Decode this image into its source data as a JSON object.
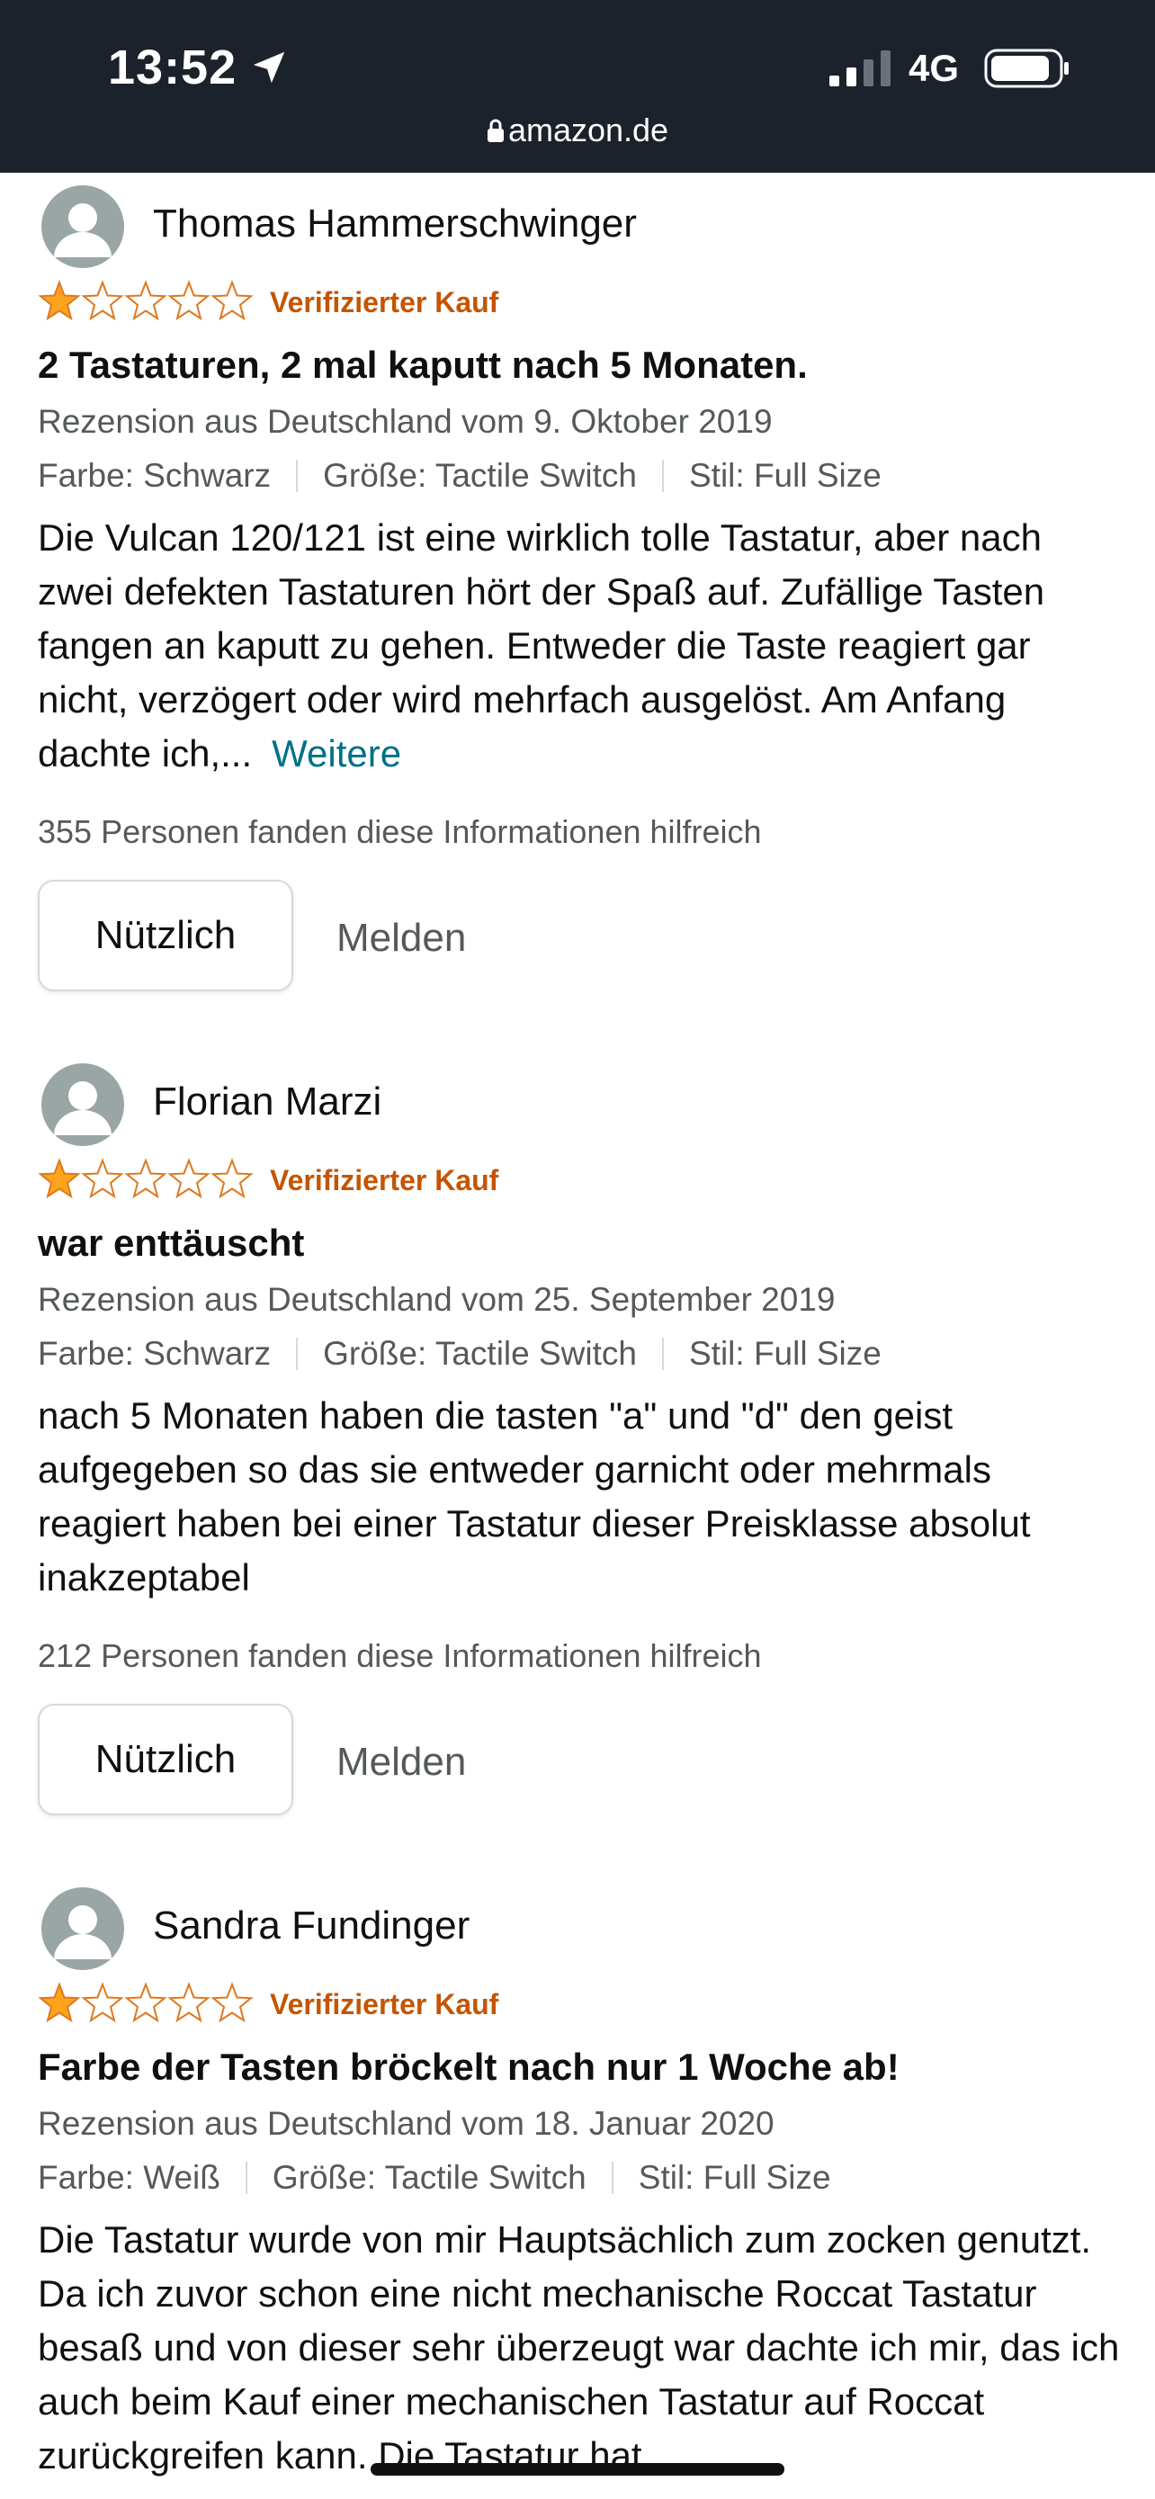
{
  "status_bar": {
    "time": "13:52",
    "network": "4G",
    "url": "amazon.de"
  },
  "colors": {
    "star_fill": "#ffa41c",
    "star_outline": "#de7921",
    "verified": "#c45500",
    "link": "#007185"
  },
  "reviews": [
    {
      "reviewer": "Thomas Hammerschwinger",
      "rating": 1,
      "verified": "Verifizierter Kauf",
      "title": "2 Tastaturen, 2 mal kaputt nach 5 Monaten.",
      "date": "Rezension aus Deutschland vom 9. Oktober 2019",
      "color": "Farbe: Schwarz",
      "size": "Größe: Tactile Switch",
      "style": "Stil: Full Size",
      "body": "Die Vulcan 120/121 ist eine wirklich tolle Tastatur, aber nach zwei defekten Tastaturen hört der Spaß auf. Zufällige Tasten fangen an kaputt zu gehen. Entweder die Taste reagiert gar nicht, verzögert oder wird mehrfach ausgelöst. Am Anfang dachte ich,...",
      "more": "Weitere",
      "helpful": "355 Personen fanden diese Informationen hilfreich",
      "helpful_button": "Nützlich",
      "report": "Melden"
    },
    {
      "reviewer": "Florian Marzi",
      "rating": 1,
      "verified": "Verifizierter Kauf",
      "title": "war enttäuscht",
      "date": "Rezension aus Deutschland vom 25. September 2019",
      "color": "Farbe: Schwarz",
      "size": "Größe: Tactile Switch",
      "style": "Stil: Full Size",
      "body": "nach 5 Monaten haben die tasten \"a\" und \"d\" den geist aufgegeben so das sie entweder garnicht oder mehrmals reagiert haben bei einer Tastatur dieser Preisklasse absolut inakzeptabel",
      "helpful": "212 Personen fanden diese Informationen hilfreich",
      "helpful_button": "Nützlich",
      "report": "Melden"
    },
    {
      "reviewer": "Sandra Fundinger",
      "rating": 1,
      "verified": "Verifizierter Kauf",
      "title": "Farbe der Tasten bröckelt nach nur 1 Woche ab!",
      "date": "Rezension aus Deutschland vom 18. Januar 2020",
      "color": "Farbe: Weiß",
      "size": "Größe: Tactile Switch",
      "style": "Stil: Full Size",
      "body": "Die Tastatur wurde von mir Hauptsächlich zum zocken genutzt. Da ich zuvor schon eine nicht mechanische Roccat Tastatur besaß und von dieser sehr überzeugt war dachte ich mir, das ich auch beim Kauf einer mechanischen Tastatur auf Roccat zurückgreifen kann. Die Tastatur hat..."
    }
  ]
}
